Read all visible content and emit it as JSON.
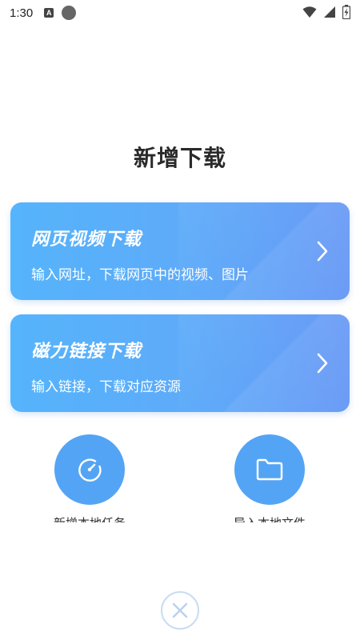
{
  "status_bar": {
    "time": "1:30",
    "notification_letter": "A"
  },
  "page": {
    "title": "新增下载"
  },
  "cards": [
    {
      "title": "网页视频下载",
      "description": "输入网址，下载网页中的视频、图片"
    },
    {
      "title": "磁力链接下载",
      "description": "输入链接，下载对应资源"
    }
  ],
  "actions": [
    {
      "label": "新增本地任务",
      "icon": "speed-dial-icon"
    },
    {
      "label": "导入本地文件",
      "icon": "folder-icon"
    }
  ],
  "close": {
    "icon": "close-icon"
  },
  "colors": {
    "card_gradient_start": "#55b4fb",
    "card_gradient_end": "#6a9bf6",
    "circle_button": "#54a4f5",
    "close_border": "#c9dcf3"
  }
}
